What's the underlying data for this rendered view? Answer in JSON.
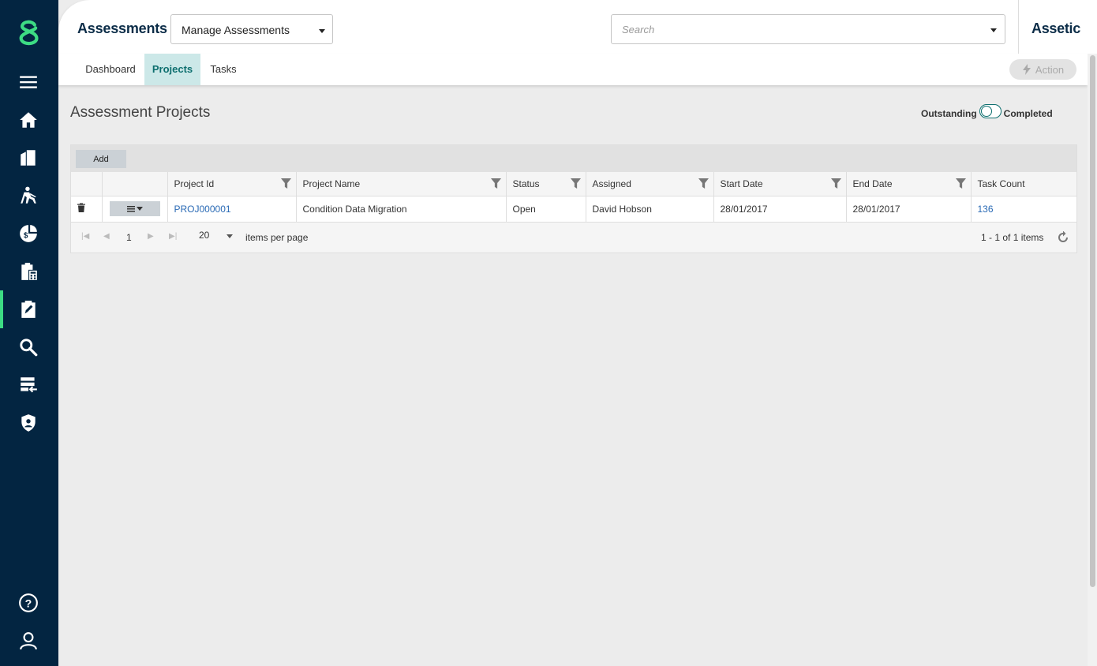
{
  "header": {
    "app_title": "Assessments",
    "module_select": "Manage Assessments",
    "search_placeholder": "Search",
    "brand": "Assetic"
  },
  "tabs": [
    "Dashboard",
    "Projects",
    "Tasks"
  ],
  "action_label": "Action",
  "page": {
    "title": "Assessment Projects",
    "toggle_left": "Outstanding",
    "toggle_right": "Completed"
  },
  "grid": {
    "add_label": "Add",
    "columns": [
      "Project Id",
      "Project Name",
      "Status",
      "Assigned",
      "Start Date",
      "End Date",
      "Task Count"
    ],
    "rows": [
      {
        "project_id": "PROJ000001",
        "project_name": "Condition Data Migration",
        "status": "Open",
        "assigned": "David Hobson",
        "start_date": "28/01/2017",
        "end_date": "28/01/2017",
        "task_count": "136"
      }
    ],
    "pager": {
      "page": "1",
      "page_size": "20",
      "items_per_page_label": "items per page",
      "info": "1 - 1 of 1 items"
    }
  },
  "sidebar_icons": [
    "logo-icon",
    "hamburger-menu-icon",
    "home-icon",
    "buildings-icon",
    "worker-icon",
    "finance-icon",
    "clipboard-calculator-icon",
    "assessment-icon",
    "search-icon",
    "data-exchange-icon",
    "security-shield-icon",
    "help-icon",
    "user-icon"
  ],
  "colors": {
    "sidebar": "#032541",
    "accent": "#3ddc84",
    "active_tab_bg": "#cce8e8",
    "active_tab_text": "#0e6f6f",
    "link": "#2a6ab5"
  }
}
